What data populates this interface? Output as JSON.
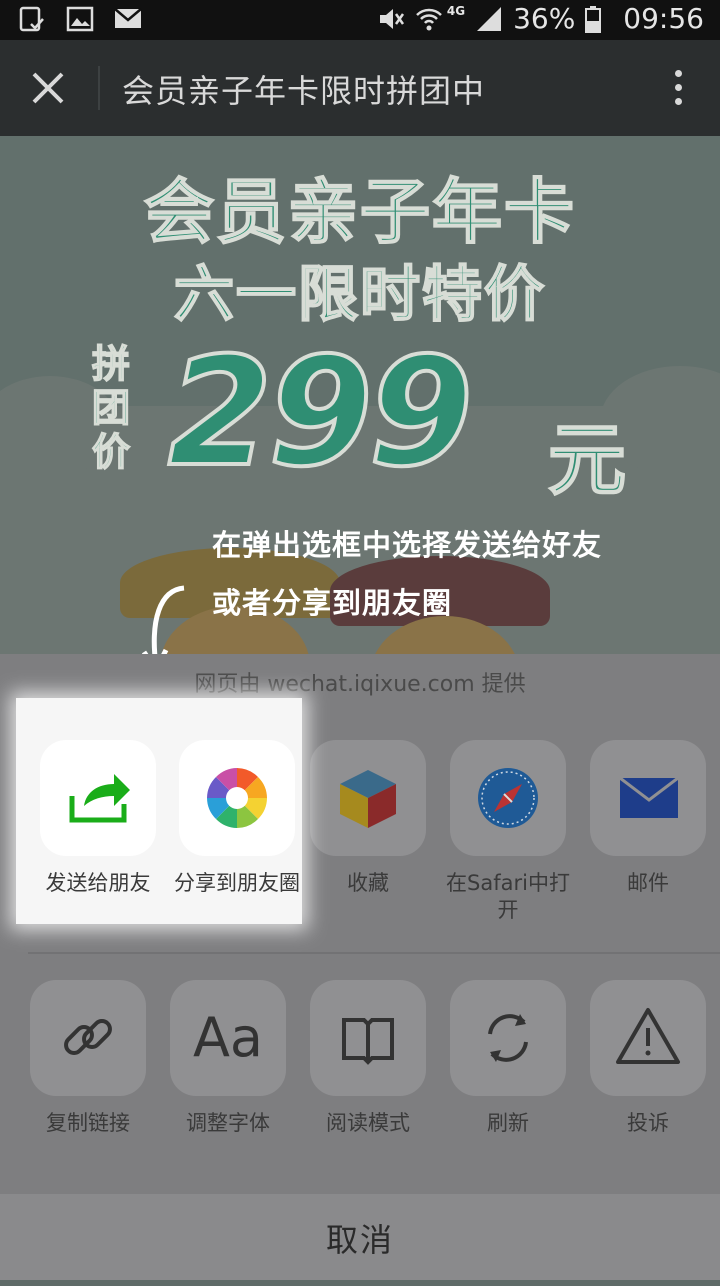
{
  "status_bar": {
    "battery": "36%",
    "time": "09:56",
    "network": "4G",
    "left_icons": [
      "tablet-check-icon",
      "image-icon",
      "mail-icon"
    ],
    "right_icons": [
      "mute-icon",
      "wifi-icon",
      "signal-icon",
      "battery-icon"
    ]
  },
  "header": {
    "title": "会员亲子年卡限时拼团中",
    "close_icon": "close-icon",
    "more_icon": "more-vertical-icon"
  },
  "poster": {
    "headline_1": "会员亲子年卡",
    "headline_2": "六一限时特价",
    "tuan_label": "拼团价",
    "price": "299",
    "unit": "元",
    "brand_color": "#2f8e73"
  },
  "annotation": {
    "line1": "在弹出选框中选择发送给好友",
    "line2": "或者分享到朋友圈"
  },
  "share_sheet": {
    "provider": "网页由 wechat.iqixue.com 提供",
    "row1": [
      {
        "label": "发送给朋友",
        "icon": "share-forward-icon"
      },
      {
        "label": "分享到朋友圈",
        "icon": "moments-icon"
      },
      {
        "label": "收藏",
        "icon": "favorite-cube-icon"
      },
      {
        "label": "在Safari中打开",
        "icon": "safari-compass-icon"
      },
      {
        "label": "邮件",
        "icon": "mail-icon"
      }
    ],
    "row2": [
      {
        "label": "复制链接",
        "icon": "link-icon"
      },
      {
        "label": "调整字体",
        "icon": "font-icon"
      },
      {
        "label": "阅读模式",
        "icon": "book-icon"
      },
      {
        "label": "刷新",
        "icon": "refresh-icon"
      },
      {
        "label": "投诉",
        "icon": "warning-icon"
      }
    ],
    "font_glyph": "Aa",
    "cancel": "取消"
  }
}
